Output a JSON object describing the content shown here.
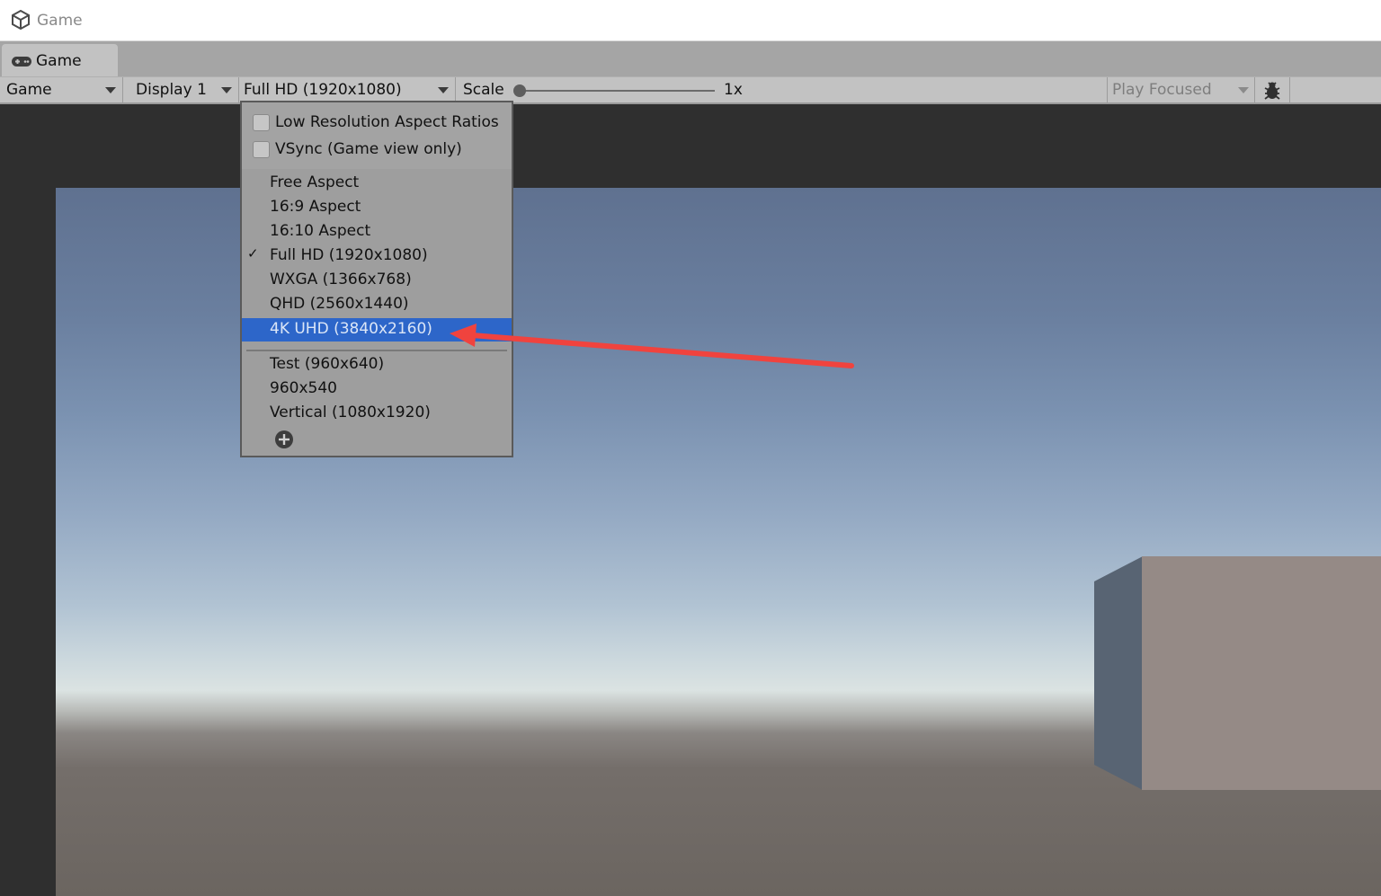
{
  "window": {
    "title": "Game",
    "app_icon": "unity-logo-icon"
  },
  "tab": {
    "label": "Game",
    "icon": "gamepad-icon"
  },
  "toolbar": {
    "view_mode": "Game",
    "display": "Display 1",
    "resolution": "Full HD (1920x1080)",
    "scale_label": "Scale",
    "scale_value": "1x",
    "scale_level": 0.0,
    "play_mode": "Play Focused",
    "debug_icon": "bug-icon"
  },
  "menu": {
    "options": [
      {
        "label": "Low Resolution Aspect Ratios",
        "checked": false
      },
      {
        "label": "VSync (Game view only)",
        "checked": false
      }
    ],
    "items": [
      {
        "label": "Free Aspect",
        "checked": false,
        "highlighted": false
      },
      {
        "label": "16:9 Aspect",
        "checked": false,
        "highlighted": false
      },
      {
        "label": "16:10 Aspect",
        "checked": false,
        "highlighted": false
      },
      {
        "label": "Full HD (1920x1080)",
        "checked": true,
        "highlighted": false,
        "check_mark": "✓"
      },
      {
        "label": "WXGA (1366x768)",
        "checked": false,
        "highlighted": false
      },
      {
        "label": "QHD (2560x1440)",
        "checked": false,
        "highlighted": false
      },
      {
        "label": "4K UHD (3840x2160)",
        "checked": false,
        "highlighted": true
      }
    ],
    "custom_items": [
      {
        "label": "Test (960x640)"
      },
      {
        "label": "960x540"
      },
      {
        "label": "Vertical (1080x1920)"
      }
    ],
    "add_icon": "plus-circle-icon"
  },
  "colors": {
    "highlight": "#2d66c9",
    "annotation_arrow": "#f0433e"
  }
}
